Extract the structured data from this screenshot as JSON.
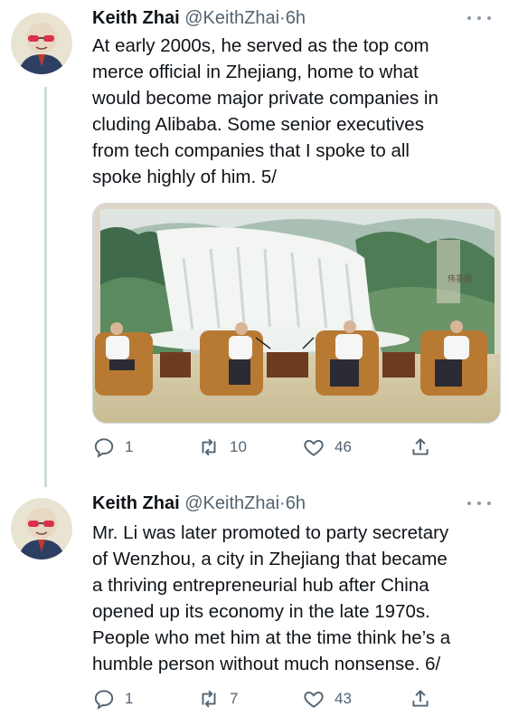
{
  "tweets": [
    {
      "author_name": "Keith Zhai",
      "handle": "@KeithZhai",
      "separator": "·",
      "time": "6h",
      "text_lines": [
        "At early 2000s, he served as the top com",
        "merce official in Zhejiang, home to what",
        "would become major private companies in",
        "cluding Alibaba. Some senior executives",
        "from tech companies that I spoke to all",
        "spoke highly of him. 5/"
      ],
      "media": {
        "seal_text": "伟景图"
      },
      "replies": "1",
      "retweets": "10",
      "likes": "46"
    },
    {
      "author_name": "Keith Zhai",
      "handle": "@KeithZhai",
      "separator": "·",
      "time": "6h",
      "text_lines": [
        "Mr. Li was later promoted to party secretary",
        "of Wenzhou, a city in Zhejiang that became",
        "a thriving entrepreneurial hub after China",
        "opened up its economy in the late 1970s.",
        "People who met him at the time think he’s a",
        "humble person without much nonsense. 6/"
      ],
      "replies": "1",
      "retweets": "7",
      "likes": "43"
    }
  ],
  "icons": {
    "avatar": "avatar-illustration",
    "more": "more-options-icon",
    "reply": "reply-icon",
    "retweet": "retweet-icon",
    "like": "like-icon",
    "share": "share-icon"
  },
  "colors": {
    "secondary_text": "#536471",
    "thread_line": "#cfd9de"
  }
}
